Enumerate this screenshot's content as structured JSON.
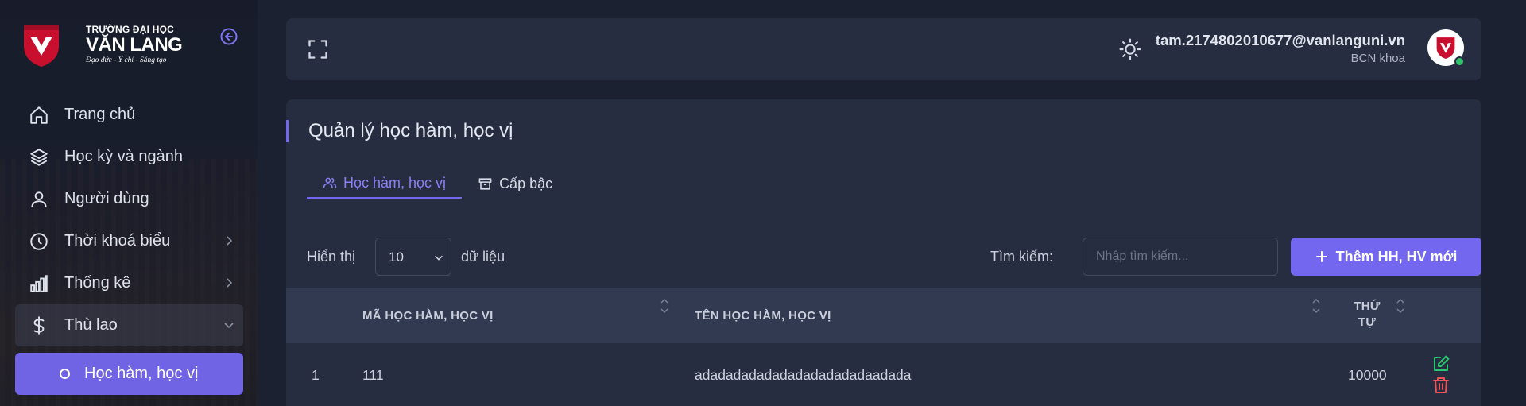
{
  "brand": {
    "line1": "TRƯỜNG ĐẠI HỌC",
    "line2": "VĂN LANG",
    "motto": "Đạo đức - Ý chí - Sáng tạo",
    "color": "#c8102e"
  },
  "sidebar": {
    "items": [
      {
        "label": "Trang chủ",
        "icon": "home-icon"
      },
      {
        "label": "Học kỳ và ngành",
        "icon": "layers-icon"
      },
      {
        "label": "Người dùng",
        "icon": "user-icon"
      },
      {
        "label": "Thời khoá biểu",
        "icon": "clock-icon",
        "has_submenu": true
      },
      {
        "label": "Thống kê",
        "icon": "bar-chart-icon",
        "has_submenu": true
      },
      {
        "label": "Thù lao",
        "icon": "dollar-icon",
        "has_submenu": true,
        "expanded": true
      }
    ],
    "active_sub": {
      "label": "Học hàm, học vị"
    }
  },
  "topbar": {
    "email": "tam.2174802010677@vanlanguni.vn",
    "role": "BCN khoa",
    "status": "online"
  },
  "page": {
    "title": "Quản lý học hàm, học vị",
    "tabs": [
      {
        "label": "Học hàm, học vị",
        "icon": "users-icon",
        "active": true
      },
      {
        "label": "Cấp bậc",
        "icon": "archive-icon",
        "active": false
      }
    ]
  },
  "controls": {
    "show_label": "Hiển thị",
    "page_size": "10",
    "data_label": "dữ liệu",
    "search_label": "Tìm kiếm:",
    "search_placeholder": "Nhập tìm kiếm...",
    "add_button": "Thêm HH, HV mới"
  },
  "table": {
    "columns": [
      "MÃ HỌC HÀM, HỌC VỊ",
      "TÊN HỌC HÀM, HỌC VỊ",
      "THỨ",
      "TỰ"
    ],
    "rows": [
      {
        "index": "1",
        "code": "111",
        "name": "adadadadadadadadadadadaadada",
        "order": "10000"
      }
    ]
  },
  "colors": {
    "accent": "#7367f0",
    "edit": "#28c76f",
    "delete": "#ea5455"
  }
}
